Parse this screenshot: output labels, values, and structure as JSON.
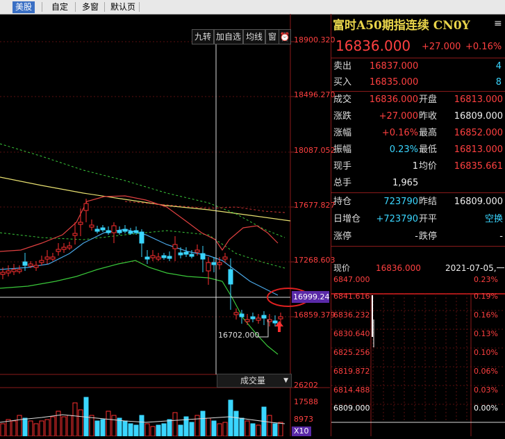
{
  "tabs": [
    {
      "label": "美股",
      "active": true
    },
    {
      "label": "自定",
      "active": false
    },
    {
      "label": "多窗",
      "active": false
    },
    {
      "label": "默认页",
      "active": false
    }
  ],
  "toolbar": {
    "btn1": "九转",
    "btn2": "加自选",
    "btn3": "均线",
    "btn4": "窗"
  },
  "price_axis": [
    "18900.320",
    "18496.270",
    "18087.052",
    "17677.827",
    "17268.603",
    "16859.379"
  ],
  "crosshair_price": "16999.24",
  "low_annotation": "16702.000",
  "volume": {
    "label": "成交量",
    "axis": [
      "26202",
      "17588",
      "8973"
    ],
    "unit": "X10"
  },
  "quote": {
    "title": "富时A50期指连续 CN0Y",
    "price": "16836.000",
    "change": "+27.000",
    "change_pct": "+0.16%",
    "sell_label": "卖出",
    "sell_price": "16837.000",
    "sell_qty": "4",
    "buy_label": "买入",
    "buy_price": "16835.000",
    "buy_qty": "8",
    "rows": [
      {
        "l1": "成交",
        "v1": "16836.000",
        "l2": "开盘",
        "v2": "16813.000"
      },
      {
        "l1": "涨跌",
        "v1": "+27.000",
        "l2": "昨收",
        "v2": "16809.000"
      },
      {
        "l1": "涨幅",
        "v1": "+0.16%",
        "l2": "最高",
        "v2": "16852.000"
      },
      {
        "l1": "振幅",
        "v1": "0.23%",
        "l2": "最低",
        "v2": "16813.000"
      },
      {
        "l1": "现手",
        "v1": "1",
        "l2": "均价",
        "v2": "16835.661"
      },
      {
        "l1": "总手",
        "v1": "1,965",
        "l2": "",
        "v2": ""
      }
    ],
    "rows2": [
      {
        "l1": "持仓",
        "v1": "723790",
        "l2": "昨结",
        "v2": "16809.000"
      },
      {
        "l1": "日增仓",
        "v1": "+723790",
        "l2": "开平",
        "v2": "空换"
      },
      {
        "l1": "涨停",
        "v1": "-",
        "l2": "跌停",
        "v2": "-"
      }
    ],
    "current_label": "现价",
    "current_value": "16836.000",
    "date": "2021-07-05,一"
  },
  "mini_chart": {
    "left_axis": [
      "6847.000",
      "6841.616",
      "6836.232",
      "6830.640",
      "6825.256",
      "6819.872",
      "6814.488",
      "6809.000"
    ],
    "right_axis": [
      "0.23%",
      "0.19%",
      "0.16%",
      "0.13%",
      "0.10%",
      "0.06%",
      "0.03%",
      "0.00%"
    ]
  },
  "colors": {
    "up": "#ff3030",
    "down": "#3ad6ff",
    "title": "#e8d44a",
    "price_axis_box": "#5a2aa8"
  }
}
